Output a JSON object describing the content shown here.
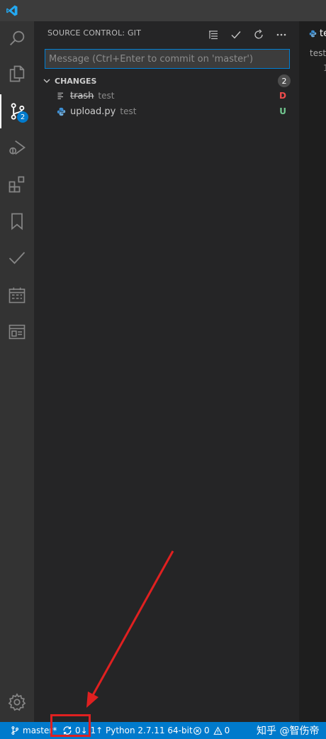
{
  "titlebar": {
    "logo_icon": "vscode-logo-icon"
  },
  "activity_bar": {
    "items": [
      {
        "name": "explorer",
        "icon": "search-icon"
      },
      {
        "name": "files",
        "icon": "files-icon"
      },
      {
        "name": "source-control",
        "icon": "source-control-icon",
        "badge": "2",
        "active": true
      },
      {
        "name": "run-debug",
        "icon": "debug-icon"
      },
      {
        "name": "extensions",
        "icon": "extensions-icon"
      },
      {
        "name": "bookmarks",
        "icon": "bookmark-icon"
      },
      {
        "name": "todo",
        "icon": "check-icon"
      },
      {
        "name": "calendar",
        "icon": "calendar-icon"
      },
      {
        "name": "browser-preview",
        "icon": "window-icon"
      },
      {
        "name": "settings",
        "icon": "gear-icon"
      }
    ]
  },
  "sidebar": {
    "title": "SOURCE CONTROL: GIT",
    "actions": [
      "list-view-icon",
      "check-icon",
      "refresh-icon",
      "more-icon"
    ],
    "message_placeholder": "Message (Ctrl+Enter to commit on 'master')",
    "changes": {
      "label": "CHANGES",
      "count": "2",
      "files": [
        {
          "name": "trash",
          "dir": "test",
          "status": "D",
          "status_color": "#f14c4c",
          "icon": "text-file-icon",
          "deleted": true
        },
        {
          "name": "upload.py",
          "dir": "test",
          "status": "U",
          "status_color": "#73c991",
          "icon": "python-file-icon",
          "deleted": false
        }
      ]
    }
  },
  "editor": {
    "tab_label": "te",
    "breadcrumb": "test",
    "line_number": "1"
  },
  "statusbar": {
    "branch": "master*",
    "sync": "0↓ 1↑",
    "python": "Python 2.7.11 64-bit",
    "errors": "0",
    "warnings": "0",
    "watermark": "知乎 @智伤帝"
  },
  "colors": {
    "accent": "#007acc",
    "annotation": "#e02020"
  }
}
